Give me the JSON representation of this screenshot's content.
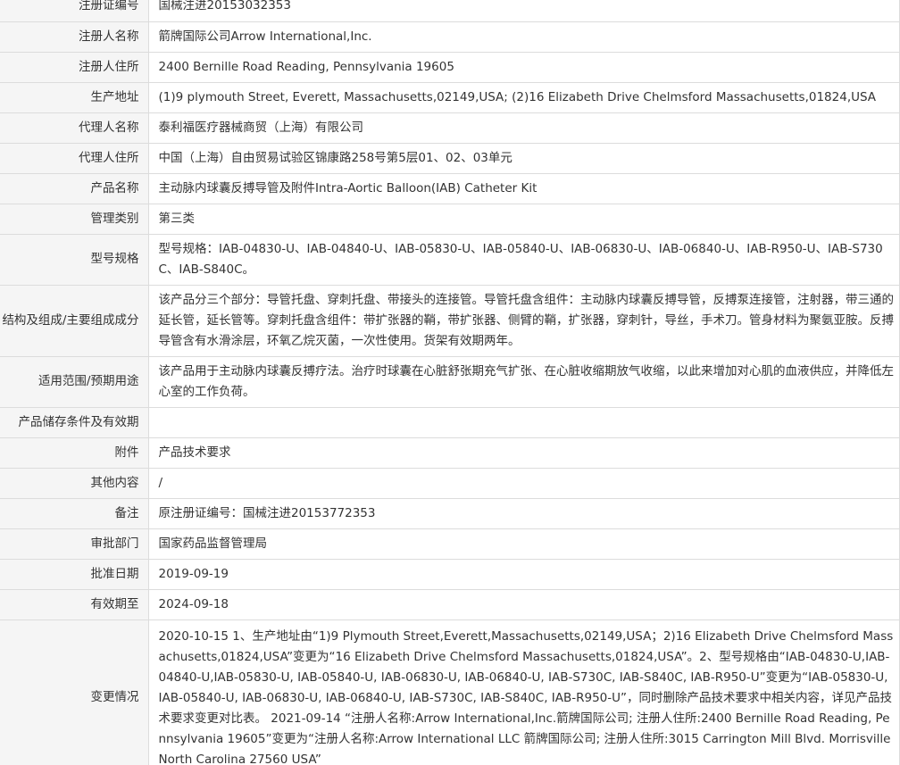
{
  "rows": [
    {
      "label": "注册证编号",
      "value": "国械注进20153032353"
    },
    {
      "label": "注册人名称",
      "value": "箭牌国际公司Arrow International,Inc."
    },
    {
      "label": "注册人住所",
      "value": "2400 Bernille Road Reading, Pennsylvania 19605"
    },
    {
      "label": "生产地址",
      "value": "(1)9 plymouth Street, Everett, Massachusetts,02149,USA; (2)16 Elizabeth Drive Chelmsford Massachusetts,01824,USA"
    },
    {
      "label": "代理人名称",
      "value": "泰利福医疗器械商贸（上海）有限公司"
    },
    {
      "label": "代理人住所",
      "value": "中国（上海）自由贸易试验区锦康路258号第5层01、02、03单元"
    },
    {
      "label": "产品名称",
      "value": "主动脉内球囊反搏导管及附件Intra-Aortic Balloon(IAB) Catheter Kit"
    },
    {
      "label": "管理类别",
      "value": "第三类"
    },
    {
      "label": "型号规格",
      "value": "型号规格：IAB-04830-U、IAB-04840-U、IAB-05830-U、IAB-05840-U、IAB-06830-U、IAB-06840-U、IAB-R950-U、IAB-S730C、IAB-S840C。"
    },
    {
      "label": "结构及组成/主要组成成分",
      "value": "该产品分三个部分：导管托盘、穿刺托盘、带接头的连接管。导管托盘含组件：主动脉内球囊反搏导管，反搏泵连接管，注射器，带三通的延长管，延长管等。穿刺托盘含组件：带扩张器的鞘，带扩张器、侧臂的鞘，扩张器，穿刺针，导丝，手术刀。管身材料为聚氨亚胺。反搏导管含有水滑涂层，环氧乙烷灭菌，一次性使用。货架有效期两年。"
    },
    {
      "label": "适用范围/预期用途",
      "value": "该产品用于主动脉内球囊反搏疗法。治疗时球囊在心脏舒张期充气扩张、在心脏收缩期放气收缩，以此来增加对心肌的血液供应，并降低左心室的工作负荷。"
    },
    {
      "label": "产品储存条件及有效期",
      "value": ""
    },
    {
      "label": "附件",
      "value": "产品技术要求"
    },
    {
      "label": "其他内容",
      "value": "/"
    },
    {
      "label": "备注",
      "value": "原注册证编号：国械注进20153772353"
    },
    {
      "label": "审批部门",
      "value": "国家药品监督管理局"
    },
    {
      "label": "批准日期",
      "value": "2019-09-19"
    },
    {
      "label": "有效期至",
      "value": "2024-09-18"
    },
    {
      "label": "变更情况",
      "value": "2020-10-15 1、生产地址由“1)9 Plymouth Street,Everett,Massachusetts,02149,USA；2)16 Elizabeth Drive Chelmsford Massachusetts,01824,USA”变更为“16 Elizabeth Drive Chelmsford Massachusetts,01824,USA”。2、型号规格由“IAB-04830-U,IAB-04840-U,IAB-05830-U, IAB-05840-U, IAB-06830-U, IAB-06840-U, IAB-S730C, IAB-S840C, IAB-R950-U”变更为“IAB-05830-U, IAB-05840-U, IAB-06830-U, IAB-06840-U, IAB-S730C, IAB-S840C, IAB-R950-U”，同时删除产品技术要求中相关内容，详见产品技术要求变更对比表。 2021-09-14 “注册人名称:Arrow International,Inc.箭牌国际公司; 注册人住所:2400 Bernille Road Reading, Pennsylvania 19605”变更为“注册人名称:Arrow International LLC 箭牌国际公司; 注册人住所:3015 Carrington Mill Blvd. Morrisville North Carolina 27560 USA”"
    }
  ]
}
